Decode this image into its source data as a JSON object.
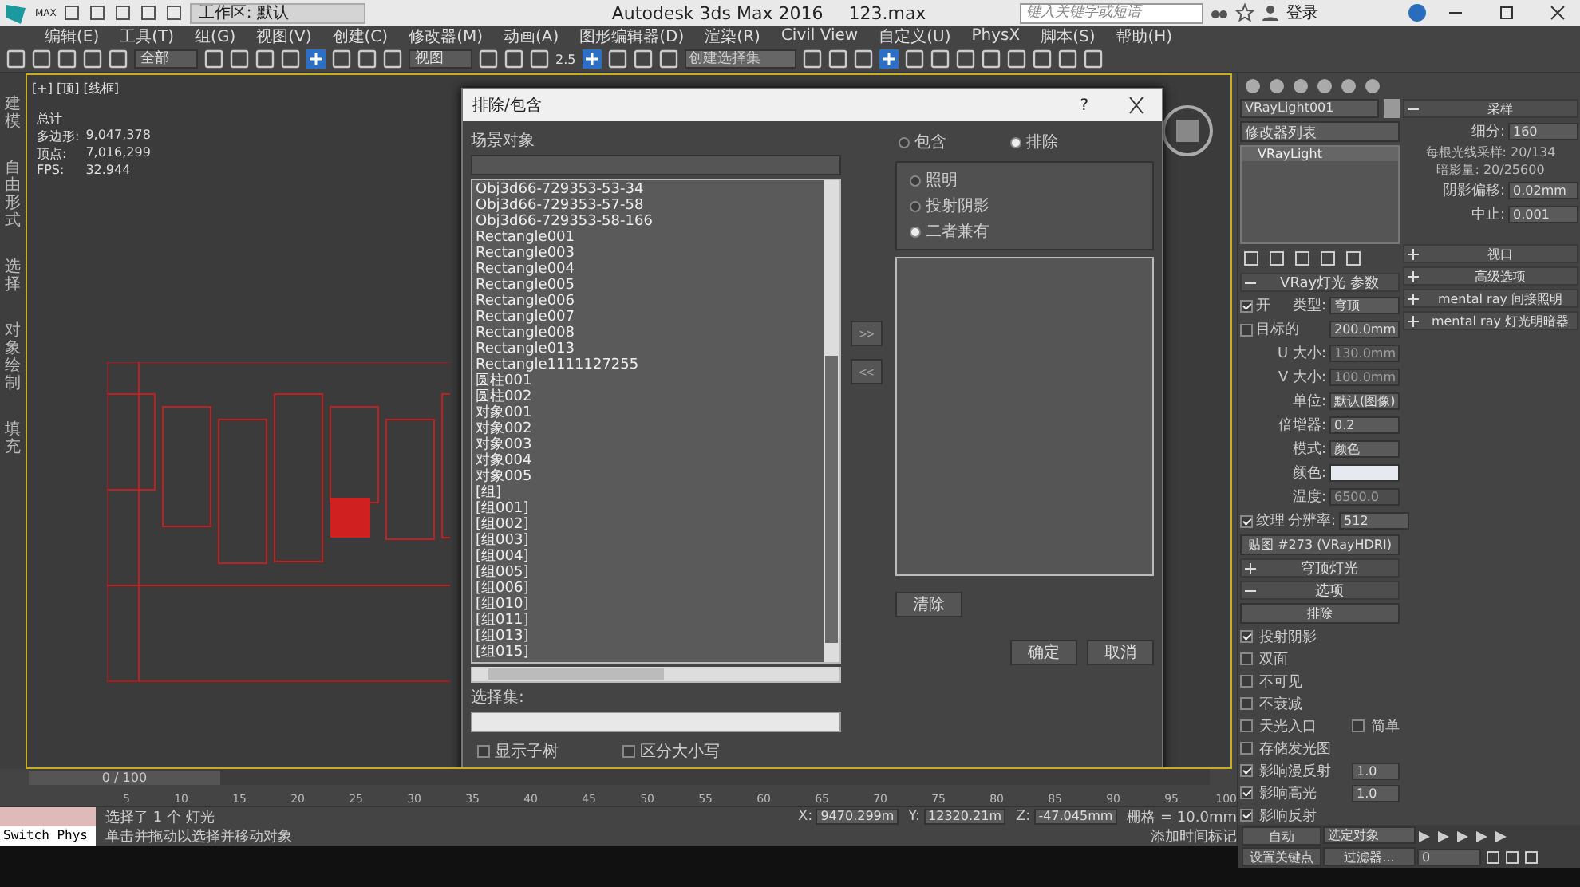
{
  "title_bar": {
    "app_button": "MAX",
    "workspace": "工作区: 默认",
    "title": "Autodesk 3ds Max 2016",
    "file": "123.max",
    "search": {
      "placeholder": "键入关键字或短语"
    },
    "sign_in": "登录"
  },
  "menu": [
    "编辑(E)",
    "工具(T)",
    "组(G)",
    "视图(V)",
    "创建(C)",
    "修改器(M)",
    "动画(A)",
    "图形编辑器(D)",
    "渲染(R)",
    "Civil View",
    "自定义(U)",
    "PhysX",
    "脚本(S)",
    "帮助(H)"
  ],
  "toolbar": {
    "selection_filter": "全部",
    "reference_coord": "视图",
    "snap_angle": "2.5",
    "selection_set": {
      "placeholder": "创建选择集"
    }
  },
  "ribbon_tabs": [
    "建模",
    "自由形式",
    "选择",
    "对象绘制",
    "填充"
  ],
  "viewport": {
    "label": "[+] [顶] [线框]",
    "stats": [
      {
        "label": "总计"
      },
      {
        "label": "多边形:",
        "value": "9,047,378"
      },
      {
        "label": "顶点:",
        "value": "7,016,299"
      },
      {
        "label": "FPS:",
        "value": "32.944"
      }
    ]
  },
  "dialog": {
    "title": "排除/包含",
    "help": "?",
    "scene_label": "场景对象",
    "objects": [
      "Obj3d66-729353-53-34",
      "Obj3d66-729353-57-58",
      "Obj3d66-729353-58-166",
      "Rectangle001",
      "Rectangle003",
      "Rectangle004",
      "Rectangle005",
      "Rectangle006",
      "Rectangle007",
      "Rectangle008",
      "Rectangle013",
      "Rectangle1111127255",
      "圆柱001",
      "圆柱002",
      "对象001",
      "对象002",
      "对象003",
      "对象004",
      "对象005",
      "[组]",
      "[组001]",
      "[组002]",
      "[组003]",
      "[组004]",
      "[组005]",
      "[组006]",
      "[组010]",
      "[组011]",
      "[组013]",
      "[组015]"
    ],
    "selection_set_label": "选择集:",
    "options": [
      {
        "label": "显示子树",
        "checked": false
      },
      {
        "label": "区分大小写",
        "checked": false
      }
    ],
    "move_right": ">>",
    "move_left": "<<",
    "mode": [
      {
        "label": "包含",
        "selected": false
      },
      {
        "label": "排除",
        "selected": true
      }
    ],
    "effect": [
      {
        "label": "照明",
        "selected": false
      },
      {
        "label": "投射阴影",
        "selected": false
      },
      {
        "label": "二者兼有",
        "selected": true
      }
    ],
    "clear": "清除",
    "ok": "确定",
    "cancel": "取消"
  },
  "command_panel": {
    "object_name": "VRayLight001",
    "modifier_list": "修改器列表",
    "stack": [
      {
        "label": "VRayLight",
        "selected": true
      }
    ],
    "params": {
      "title": "VRay灯光 参数",
      "expanded": true,
      "rows": [
        {
          "kind": "check_field",
          "label": "开",
          "checked": true,
          "field_label": "类型:",
          "value": "穹顶"
        },
        {
          "kind": "check_field",
          "label": "目标的",
          "checked": false,
          "field_label": "",
          "value": "200.0mm"
        },
        {
          "kind": "field",
          "label": "U 大小:",
          "value": "130.0mm",
          "disabled": true
        },
        {
          "kind": "field",
          "label": "V 大小:",
          "value": "100.0mm",
          "disabled": true
        },
        {
          "kind": "field",
          "label": "单位:",
          "value": "默认(图像)",
          "disabled": false
        },
        {
          "kind": "field",
          "label": "倍增器:",
          "value": "0.2",
          "disabled": false
        },
        {
          "kind": "field",
          "label": "模式:",
          "value": "颜色",
          "disabled": false
        },
        {
          "kind": "swatch",
          "label": "颜色:"
        },
        {
          "kind": "field",
          "label": "温度:",
          "value": "6500.0",
          "disabled": true
        },
        {
          "kind": "check_field",
          "label": "纹理",
          "checked": true,
          "field_label": "分辨率:",
          "value": "512"
        },
        {
          "kind": "button",
          "label": "贴图 #273 (VRayHDRI)"
        }
      ]
    },
    "rollouts": [
      {
        "label": "穹顶灯光",
        "expanded": false
      },
      {
        "label": "选项",
        "expanded": true
      }
    ],
    "exclude_button": "排除",
    "options": [
      {
        "label": "投射阴影",
        "checked": true
      },
      {
        "label": "双面",
        "checked": false
      },
      {
        "label": "不可见",
        "checked": false
      },
      {
        "label": "不衰减",
        "checked": false
      },
      {
        "label": "天光入口",
        "checked": false,
        "extra": {
          "label": "简单",
          "checked": false
        }
      },
      {
        "label": "存储发光图",
        "checked": false
      },
      {
        "label": "影响漫反射",
        "checked": true,
        "value": "1.0"
      },
      {
        "label": "影响高光",
        "checked": true,
        "value": "1.0"
      },
      {
        "label": "影响反射",
        "checked": true
      }
    ],
    "sampling": {
      "title": "采样",
      "expanded": true,
      "rows": [
        {
          "kind": "field",
          "label": "细分:",
          "value": "160",
          "disabled": false
        },
        {
          "kind": "note",
          "label": "每根光线采样: 20/134"
        },
        {
          "kind": "note",
          "label": "暗影量: 20/25600"
        },
        {
          "kind": "field",
          "label": "阴影偏移:",
          "value": "0.02mm",
          "disabled": false
        },
        {
          "kind": "field",
          "label": "中止:",
          "value": "0.001",
          "disabled": false
        }
      ]
    },
    "more_rollouts": [
      {
        "label": "视口",
        "expanded": false
      },
      {
        "label": "高级选项",
        "expanded": false
      },
      {
        "label": "mental ray 间接照明",
        "expanded": false
      },
      {
        "label": "mental ray 灯光明暗器",
        "expanded": false
      }
    ]
  },
  "anim": {
    "auto_key": "自动",
    "key_filter": "选定对象",
    "set_key": "设置关键点",
    "filters": "过滤器...",
    "frame": "0"
  },
  "timeline": {
    "position": "0 / 100",
    "level": 0,
    "ticks": [
      "5",
      "10",
      "15",
      "20",
      "25",
      "30",
      "35",
      "40",
      "45",
      "50",
      "55",
      "60",
      "65",
      "70",
      "75",
      "80",
      "85",
      "90",
      "95",
      "100"
    ]
  },
  "status": {
    "script_label": "Switch Phys",
    "prompt": "选择了 1 个 灯光",
    "hint": "单击并拖动以选择并移动对象",
    "coords": [
      {
        "axis": "X:",
        "value": "9470.299m"
      },
      {
        "axis": "Y:",
        "value": "12320.21m"
      },
      {
        "axis": "Z:",
        "value": "-47.045mm"
      }
    ],
    "grid": "栅格 = 10.0mm",
    "time_tag": "添加时间标记"
  }
}
